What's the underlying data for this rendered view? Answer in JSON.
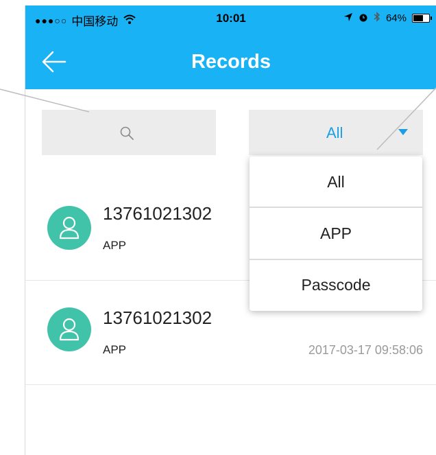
{
  "statusbar": {
    "signal": "●●●○○",
    "carrier": "中国移动",
    "time": "10:01",
    "battery": "64%",
    "battery_level": 0.64,
    "icons": [
      "wifi-icon",
      "location-arrow-icon",
      "alarm-icon",
      "bluetooth-icon",
      "battery-icon"
    ]
  },
  "header": {
    "title": "Records",
    "back_icon": "back-arrow-icon",
    "background": "#19b2f4"
  },
  "filters": {
    "search_icon": "search-icon",
    "selected": "All",
    "caret_icon": "caret-down-icon",
    "accent": "#1a9fe4"
  },
  "dropdown": {
    "options": [
      "All",
      "APP",
      "Passcode"
    ]
  },
  "records": [
    {
      "phone": "13761021302",
      "type": "APP",
      "time": ""
    },
    {
      "phone": "13761021302",
      "type": "APP",
      "time": "2017-03-17 09:58:06"
    }
  ],
  "avatar_color": "#41c3a9"
}
